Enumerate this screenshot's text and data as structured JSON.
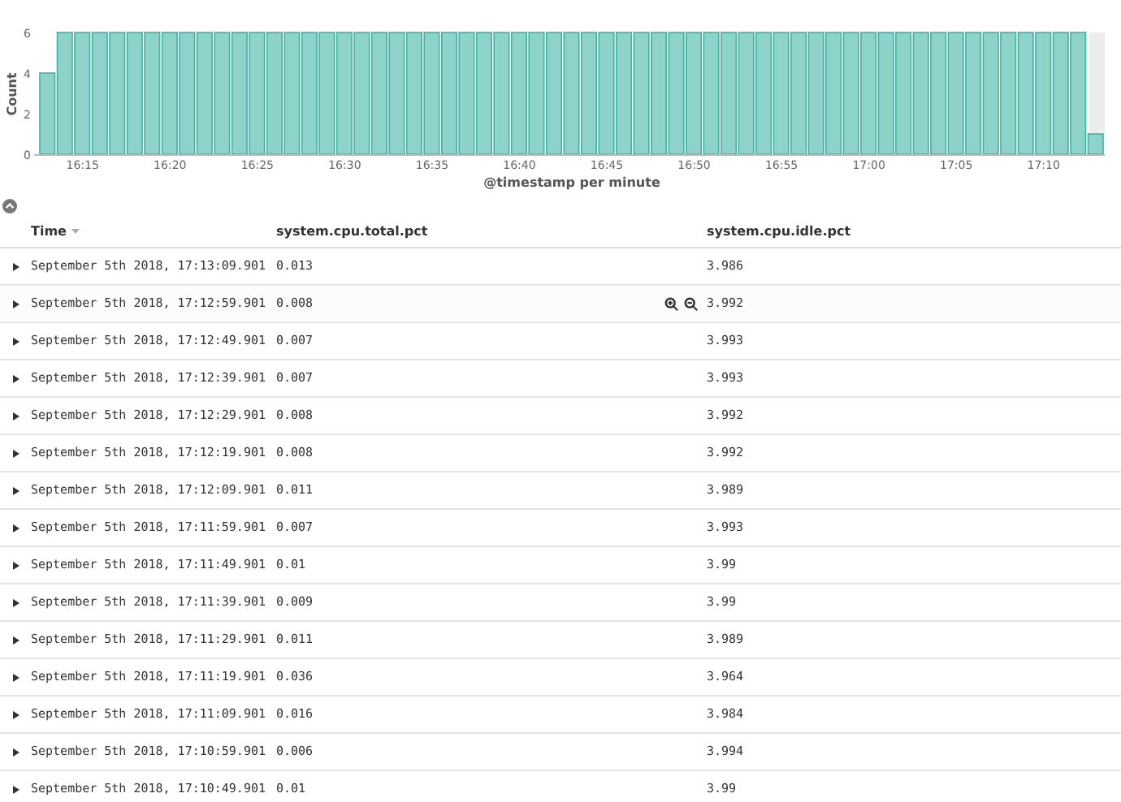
{
  "chart": {
    "chart_data": {
      "type": "bar",
      "xlabel": "@timestamp per minute",
      "ylabel": "Count",
      "x": [
        973,
        974,
        975,
        976,
        977,
        978,
        979,
        980,
        981,
        982,
        983,
        984,
        985,
        986,
        987,
        988,
        989,
        990,
        991,
        992,
        993,
        994,
        995,
        996,
        997,
        998,
        999,
        1000,
        1001,
        1002,
        1003,
        1004,
        1005,
        1006,
        1007,
        1008,
        1009,
        1010,
        1011,
        1012,
        1013,
        1014,
        1015,
        1016,
        1017,
        1018,
        1019,
        1020,
        1021,
        1022,
        1023,
        1024,
        1025,
        1026,
        1027,
        1028,
        1029,
        1030,
        1031,
        1032,
        1033
      ],
      "series": [
        {
          "color": "#8ed3c9",
          "values": [
            4,
            6,
            6,
            6,
            6,
            6,
            6,
            6,
            6,
            6,
            6,
            6,
            6,
            6,
            6,
            6,
            6,
            6,
            6,
            6,
            6,
            6,
            6,
            6,
            6,
            6,
            6,
            6,
            6,
            6,
            6,
            6,
            6,
            6,
            6,
            6,
            6,
            6,
            6,
            6,
            6,
            6,
            6,
            6,
            6,
            6,
            6,
            6,
            6,
            6,
            6,
            6,
            6,
            6,
            6,
            6,
            6,
            6,
            6,
            6,
            1
          ]
        }
      ],
      "xlim": [
        972.5,
        1033.5
      ],
      "ylim": [
        0,
        6
      ],
      "yticks": [
        0,
        2,
        4,
        6
      ],
      "xticks": [
        {
          "value": 975,
          "label": "16:15"
        },
        {
          "value": 980,
          "label": "16:20"
        },
        {
          "value": 985,
          "label": "16:25"
        },
        {
          "value": 990,
          "label": "16:30"
        },
        {
          "value": 995,
          "label": "16:35"
        },
        {
          "value": 1000,
          "label": "16:40"
        },
        {
          "value": 1005,
          "label": "16:45"
        },
        {
          "value": 1010,
          "label": "16:50"
        },
        {
          "value": 1015,
          "label": "16:55"
        },
        {
          "value": 1020,
          "label": "17:00"
        },
        {
          "value": 1025,
          "label": "17:05"
        },
        {
          "value": 1030,
          "label": "17:10"
        }
      ]
    }
  },
  "table": {
    "columns": [
      "Time",
      "system.cpu.total.pct",
      "system.cpu.idle.pct"
    ],
    "rows": [
      {
        "time": "September 5th 2018, 17:13:09.901",
        "total": "0.013",
        "idle": "3.986",
        "hovered": false
      },
      {
        "time": "September 5th 2018, 17:12:59.901",
        "total": "0.008",
        "idle": "3.992",
        "hovered": true
      },
      {
        "time": "September 5th 2018, 17:12:49.901",
        "total": "0.007",
        "idle": "3.993",
        "hovered": false
      },
      {
        "time": "September 5th 2018, 17:12:39.901",
        "total": "0.007",
        "idle": "3.993",
        "hovered": false
      },
      {
        "time": "September 5th 2018, 17:12:29.901",
        "total": "0.008",
        "idle": "3.992",
        "hovered": false
      },
      {
        "time": "September 5th 2018, 17:12:19.901",
        "total": "0.008",
        "idle": "3.992",
        "hovered": false
      },
      {
        "time": "September 5th 2018, 17:12:09.901",
        "total": "0.011",
        "idle": "3.989",
        "hovered": false
      },
      {
        "time": "September 5th 2018, 17:11:59.901",
        "total": "0.007",
        "idle": "3.993",
        "hovered": false
      },
      {
        "time": "September 5th 2018, 17:11:49.901",
        "total": "0.01",
        "idle": "3.99",
        "hovered": false
      },
      {
        "time": "September 5th 2018, 17:11:39.901",
        "total": "0.009",
        "idle": "3.99",
        "hovered": false
      },
      {
        "time": "September 5th 2018, 17:11:29.901",
        "total": "0.011",
        "idle": "3.989",
        "hovered": false
      },
      {
        "time": "September 5th 2018, 17:11:19.901",
        "total": "0.036",
        "idle": "3.964",
        "hovered": false
      },
      {
        "time": "September 5th 2018, 17:11:09.901",
        "total": "0.016",
        "idle": "3.984",
        "hovered": false
      },
      {
        "time": "September 5th 2018, 17:10:59.901",
        "total": "0.006",
        "idle": "3.994",
        "hovered": false
      },
      {
        "time": "September 5th 2018, 17:10:49.901",
        "total": "0.01",
        "idle": "3.99",
        "hovered": false
      }
    ]
  }
}
